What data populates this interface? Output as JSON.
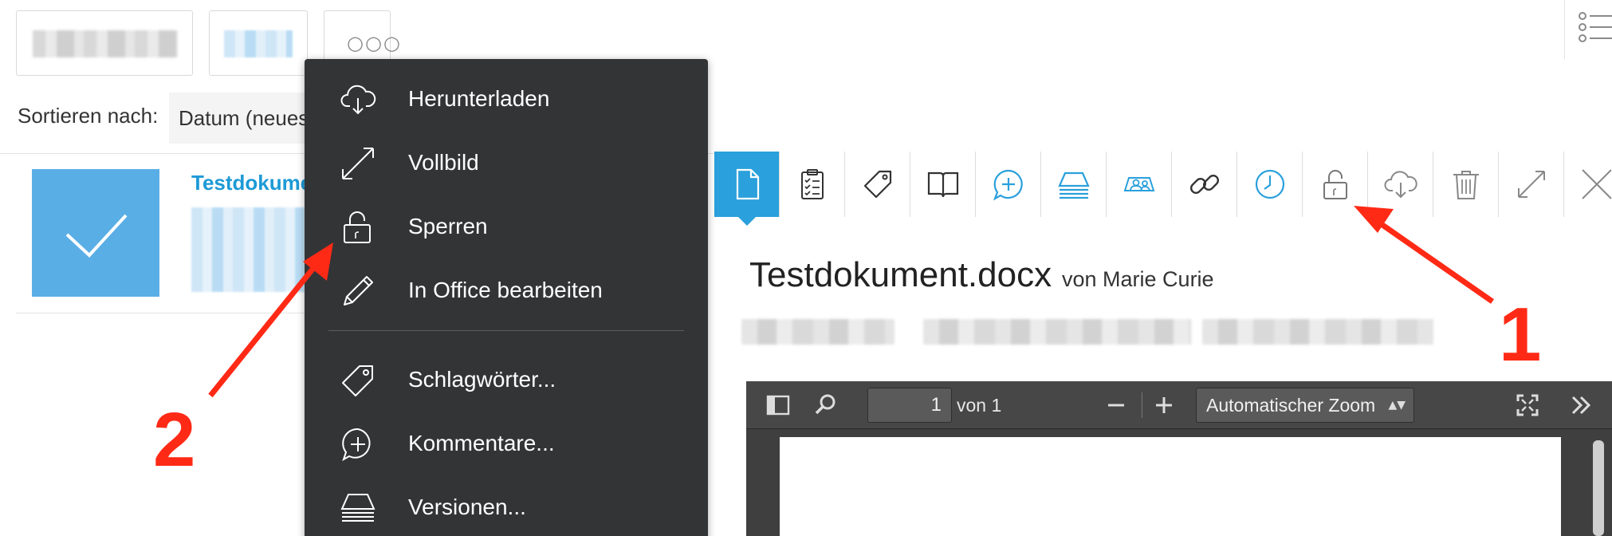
{
  "list": {
    "more_button_label": "○○○",
    "sort_label": "Sortieren nach:",
    "sort_value": "Datum (neueste zuerst)",
    "item_title": "Testdokument.docx"
  },
  "context_menu": {
    "items": [
      {
        "label": "Herunterladen",
        "icon": "cloud-download-icon"
      },
      {
        "label": "Vollbild",
        "icon": "expand-icon"
      },
      {
        "label": "Sperren",
        "icon": "lock-open-icon"
      },
      {
        "label": "In Office bearbeiten",
        "icon": "pencil-icon"
      },
      {
        "label": "Schlagwörter...",
        "icon": "tag-icon"
      },
      {
        "label": "Kommentare...",
        "icon": "comment-plus-icon"
      },
      {
        "label": "Versionen...",
        "icon": "versions-icon"
      }
    ]
  },
  "document": {
    "title": "Testdokument.docx",
    "by": "von Marie Curie",
    "toolbar_icons": [
      "document-icon",
      "clipboard-checklist-icon",
      "tag-icon",
      "book-icon",
      "comment-plus-icon",
      "versions-icon",
      "shared-users-icon",
      "link-icon",
      "clock-icon",
      "lock-open-icon",
      "cloud-download-icon",
      "trash-icon",
      "expand-icon",
      "close-icon"
    ],
    "viewer": {
      "page_number": "1",
      "page_of": "von 1",
      "zoom_value": "Automatischer Zoom",
      "zoom_arrows": "▲▼"
    }
  },
  "annotations": {
    "label_1": "1",
    "label_2": "2"
  },
  "colors": {
    "accent": "#2aa0dc",
    "menu_bg": "#333436",
    "annotation": "#ff2a16",
    "link_blue": "#1d9ad6"
  }
}
